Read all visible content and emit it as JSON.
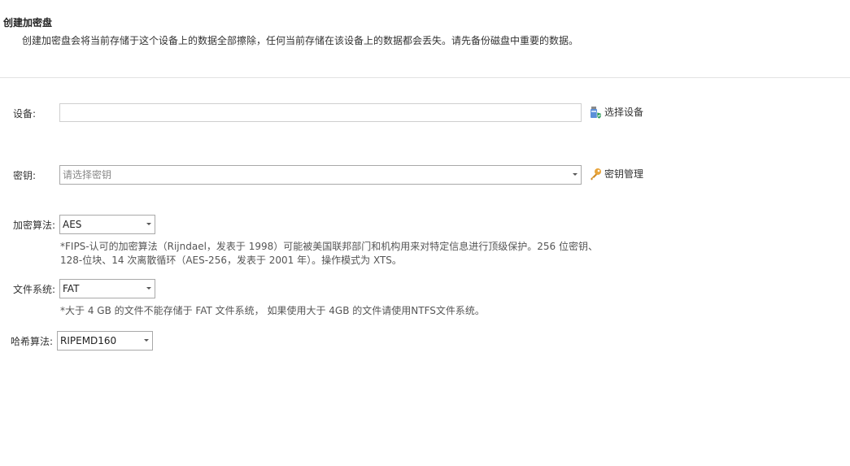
{
  "header": {
    "title": "创建加密盘",
    "description": "创建加密盘会将当前存储于这个设备上的数据全部擦除，任何当前存储在该设备上的数据都会丢失。请先备份磁盘中重要的数据。"
  },
  "device": {
    "label": "设备:",
    "value": "",
    "select_label": "选择设备",
    "select_icon": "usb-drive-shield-icon"
  },
  "key": {
    "label": "密钥:",
    "placeholder": "请选择密钥",
    "manage_label": "密钥管理",
    "manage_icon": "key-icon"
  },
  "algorithm": {
    "label": "加密算法:",
    "selected": "AES",
    "note_line1": "*FIPS-认可的加密算法（Rijndael，发表于 1998）可能被美国联邦部门和机构用来对特定信息进行顶级保护。256 位密钥、",
    "note_line2": "128-位块、14 次离散循环（AES-256，发表于 2001 年）。操作模式为 XTS。"
  },
  "filesystem": {
    "label": "文件系统:",
    "selected": "FAT",
    "note": "*大于 4 GB 的文件不能存储于 FAT 文件系统， 如果使用大于 4GB 的文件请使用NTFS文件系统。"
  },
  "hash": {
    "label": "哈希算法:",
    "selected": "RIPEMD160"
  },
  "colors": {
    "key_icon": "#e8a43a",
    "device_icon": "#3a7bd5"
  }
}
